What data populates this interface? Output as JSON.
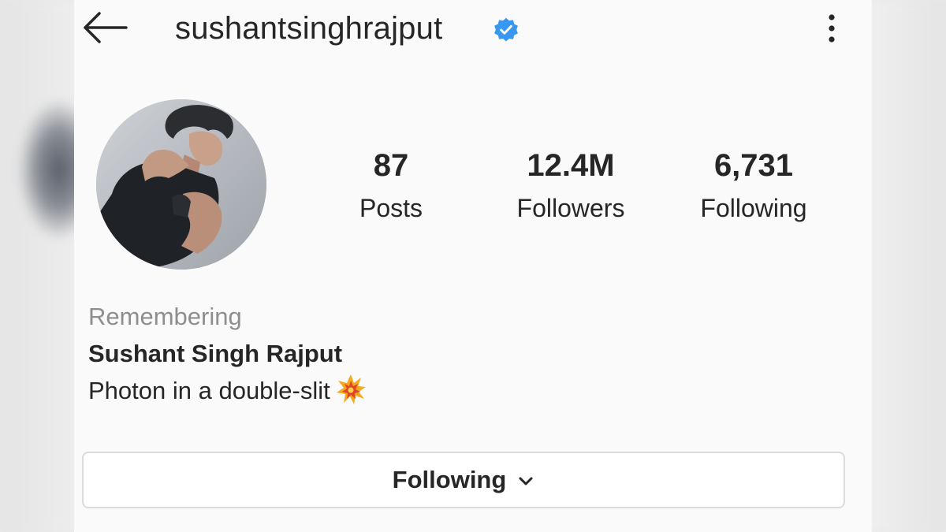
{
  "header": {
    "username": "sushantsinghrajput",
    "verified": true,
    "back_icon": "arrow-left-icon",
    "more_icon": "more-vertical-icon",
    "verified_color": "#3897f0"
  },
  "profile": {
    "avatar_alt": "profile-photo"
  },
  "stats": {
    "posts": {
      "value": "87",
      "label": "Posts"
    },
    "followers": {
      "value": "12.4M",
      "label": "Followers"
    },
    "following": {
      "value": "6,731",
      "label": "Following"
    }
  },
  "bio": {
    "remembering": "Remembering",
    "name": "Sushant Singh Rajput",
    "text": "Photon in a double-slit",
    "emoji_icon": "collision-icon"
  },
  "follow_button": {
    "label": "Following",
    "icon": "chevron-down-icon"
  },
  "colors": {
    "text": "#262626",
    "secondary_text": "#8e8e8e",
    "border": "#dbdbdb",
    "panel_bg": "#fafafa"
  }
}
